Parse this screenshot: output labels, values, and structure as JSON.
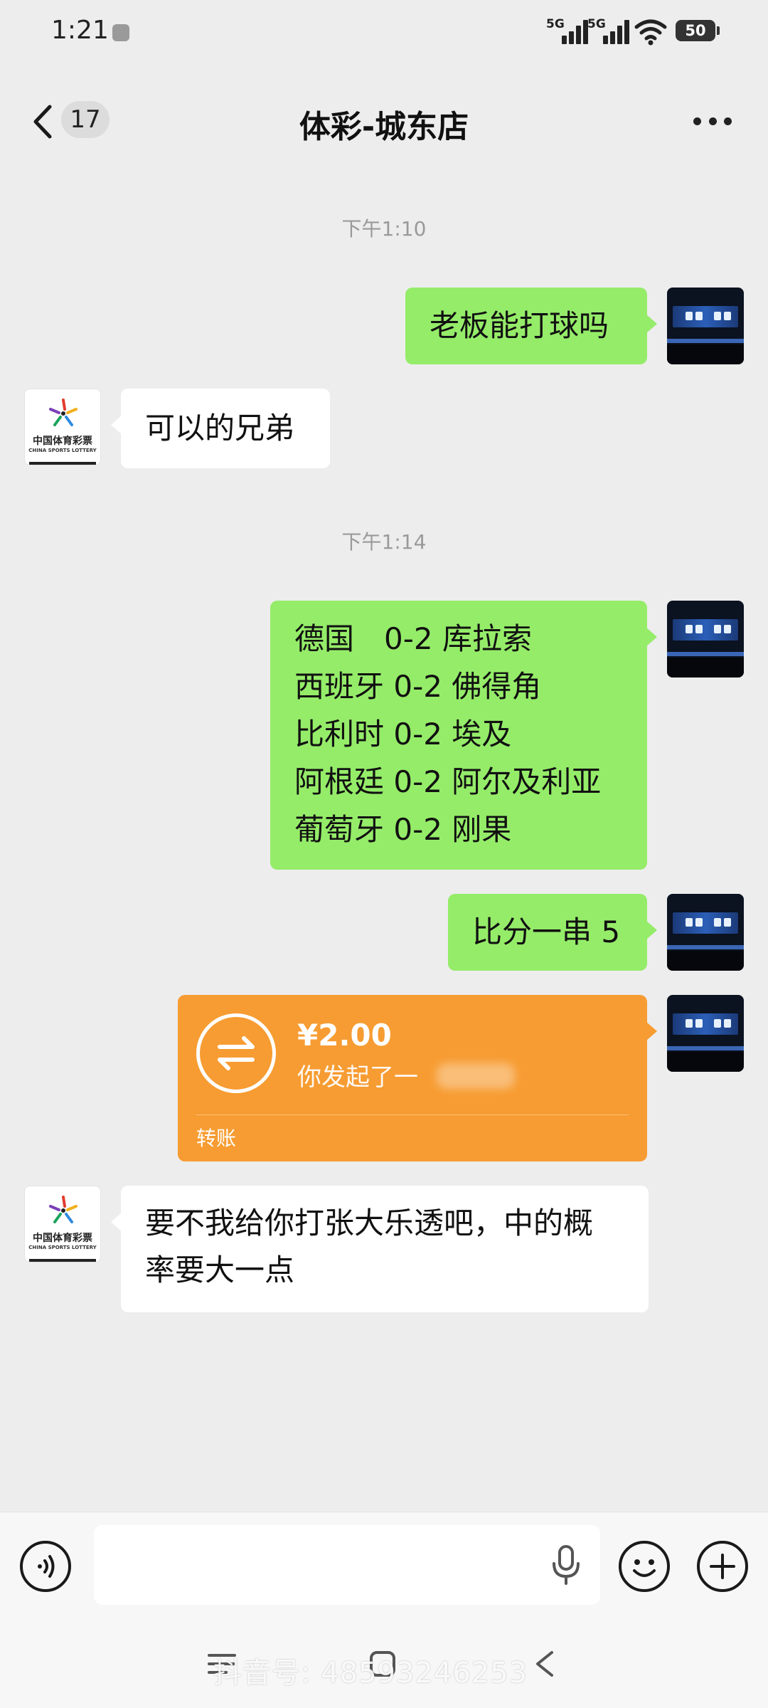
{
  "status_bar": {
    "time": "1:21",
    "network_1": "5G",
    "network_2": "5G",
    "battery": "50"
  },
  "header": {
    "back_icon": "chevron-left-icon",
    "unread_count": "17",
    "title": "体彩-城东店",
    "more_icon": "more-dots-icon"
  },
  "messages": {
    "ts1": "下午1:10",
    "m1": "老板能打球吗",
    "m2": "可以的兄弟",
    "ts2": "下午1:14",
    "m3": [
      "德国　0-2 库拉索",
      "西班牙 0-2 佛得角",
      "比利时 0-2 埃及",
      "阿根廷 0-2 阿尔及利亚",
      "葡萄牙 0-2 刚果"
    ],
    "m4": "比分一串 5",
    "transfer": {
      "amount": "¥2.00",
      "desc": "你发起了一",
      "label": "转账"
    },
    "m5": [
      "要不我给你打张大乐透吧，中的概",
      "率要大一点"
    ]
  },
  "shop_avatar": {
    "cn": "中国体育彩票",
    "en": "CHINA SPORTS LOTTERY"
  },
  "watermark": "抖音号: 48593246253",
  "colors": {
    "self_bubble": "#95ec69",
    "transfer": "#f79c32",
    "background": "#ededed"
  }
}
